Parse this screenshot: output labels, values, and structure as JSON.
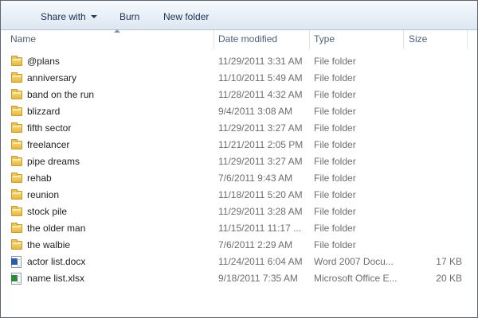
{
  "toolbar": {
    "share_label": "Share with",
    "burn_label": "Burn",
    "new_folder_label": "New folder"
  },
  "columns": {
    "name": "Name",
    "date": "Date modified",
    "type": "Type",
    "size": "Size"
  },
  "sort": {
    "column": "Name",
    "direction": "ascending"
  },
  "files": [
    {
      "name": "@plans",
      "date": "11/29/2011 3:31 AM",
      "type": "File folder",
      "size": "",
      "icon": "folder-icon"
    },
    {
      "name": "anniversary",
      "date": "11/10/2011 5:49 AM",
      "type": "File folder",
      "size": "",
      "icon": "folder-icon"
    },
    {
      "name": "band on the run",
      "date": "11/28/2011 4:32 AM",
      "type": "File folder",
      "size": "",
      "icon": "folder-icon"
    },
    {
      "name": "blizzard",
      "date": "9/4/2011 3:08 AM",
      "type": "File folder",
      "size": "",
      "icon": "folder-icon"
    },
    {
      "name": "fifth sector",
      "date": "11/29/2011 3:27 AM",
      "type": "File folder",
      "size": "",
      "icon": "folder-icon"
    },
    {
      "name": "freelancer",
      "date": "11/21/2011 2:05 PM",
      "type": "File folder",
      "size": "",
      "icon": "folder-icon"
    },
    {
      "name": "pipe dreams",
      "date": "11/29/2011 3:27 AM",
      "type": "File folder",
      "size": "",
      "icon": "folder-icon"
    },
    {
      "name": "rehab",
      "date": "7/6/2011 9:43 AM",
      "type": "File folder",
      "size": "",
      "icon": "folder-icon"
    },
    {
      "name": "reunion",
      "date": "11/18/2011 5:20 AM",
      "type": "File folder",
      "size": "",
      "icon": "folder-icon"
    },
    {
      "name": "stock pile",
      "date": "11/29/2011 3:28 AM",
      "type": "File folder",
      "size": "",
      "icon": "folder-icon"
    },
    {
      "name": "the older man",
      "date": "11/15/2011 11:17 ...",
      "type": "File folder",
      "size": "",
      "icon": "folder-icon"
    },
    {
      "name": "the walbie",
      "date": "7/6/2011 2:29 AM",
      "type": "File folder",
      "size": "",
      "icon": "folder-icon"
    },
    {
      "name": "actor list.docx",
      "date": "11/24/2011 6:04 AM",
      "type": "Word 2007 Docu...",
      "size": "17 KB",
      "icon": "word-doc-icon"
    },
    {
      "name": "name list.xlsx",
      "date": "9/18/2011 7:35 AM",
      "type": "Microsoft Office E...",
      "size": "20 KB",
      "icon": "excel-doc-icon"
    }
  ]
}
